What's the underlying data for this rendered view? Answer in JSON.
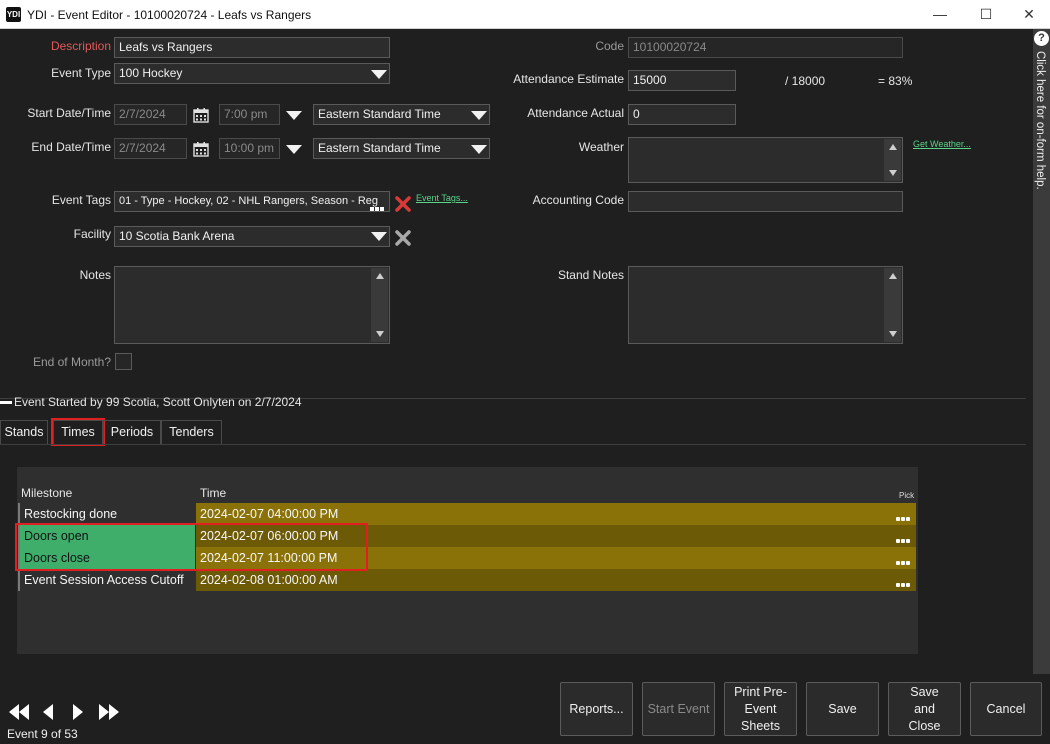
{
  "window": {
    "app_icon": "YDI",
    "title": "YDI - Event Editor - 10100020724 - Leafs vs Rangers",
    "minimize": "—",
    "maximize": "☐",
    "close": "✕"
  },
  "form": {
    "description_label": "Description",
    "description_value": "Leafs vs Rangers",
    "event_type_label": "Event Type",
    "event_type_value": "100 Hockey",
    "start_label": "Start Date/Time",
    "start_date": "2/7/2024",
    "start_time": "7:00 pm",
    "start_tz": "Eastern Standard Time",
    "end_label": "End Date/Time",
    "end_date": "2/7/2024",
    "end_time": "10:00 pm",
    "end_tz": "Eastern Standard Time",
    "tags_label": "Event Tags",
    "tags_value": "01 - Type - Hockey, 02 - NHL Rangers, Season - Reg",
    "tags_link": "Event Tags...",
    "facility_label": "Facility",
    "facility_value": "10 Scotia Bank Arena",
    "notes_label": "Notes",
    "end_of_month_label": "End of Month?",
    "code_label": "Code",
    "code_value": "10100020724",
    "att_est_label": "Attendance Estimate",
    "att_est_value": "15000",
    "att_capacity": "/ 18000",
    "att_percent": "= 83%",
    "att_actual_label": "Attendance Actual",
    "att_actual_value": "0",
    "weather_label": "Weather",
    "weather_link": "Get Weather...",
    "accounting_label": "Accounting Code",
    "stand_notes_label": "Stand Notes"
  },
  "help": {
    "text": "Click here for on-form help.",
    "icon": "?"
  },
  "status": {
    "started": "Event Started by 99 Scotia, Scott Onlyten on 2/7/2024"
  },
  "tabs": [
    {
      "label": "Stands"
    },
    {
      "label": "Times"
    },
    {
      "label": "Periods"
    },
    {
      "label": "Tenders"
    }
  ],
  "grid": {
    "col_milestone": "Milestone",
    "col_time": "Time",
    "col_pick": "Pick",
    "rows": [
      {
        "milestone": "Restocking done",
        "time": "2024-02-07 04:00:00 PM"
      },
      {
        "milestone": "Doors open",
        "time": "2024-02-07 06:00:00 PM"
      },
      {
        "milestone": "Doors close",
        "time": "2024-02-07 11:00:00 PM"
      },
      {
        "milestone": "Event Session Access Cutoff",
        "time": "2024-02-08 01:00:00 AM"
      }
    ]
  },
  "footer": {
    "event_count": "Event 9 of 53",
    "reports": "Reports...",
    "start_event": "Start Event",
    "print_pre": "Print Pre-Event Sheets",
    "save": "Save",
    "save_close": "Save and Close",
    "cancel": "Cancel"
  },
  "colors": {
    "gold_row": "#8a7208",
    "gold_row_dark": "#6d5a07",
    "green_cell": "#3fae6b",
    "highlight": "#e02020"
  }
}
